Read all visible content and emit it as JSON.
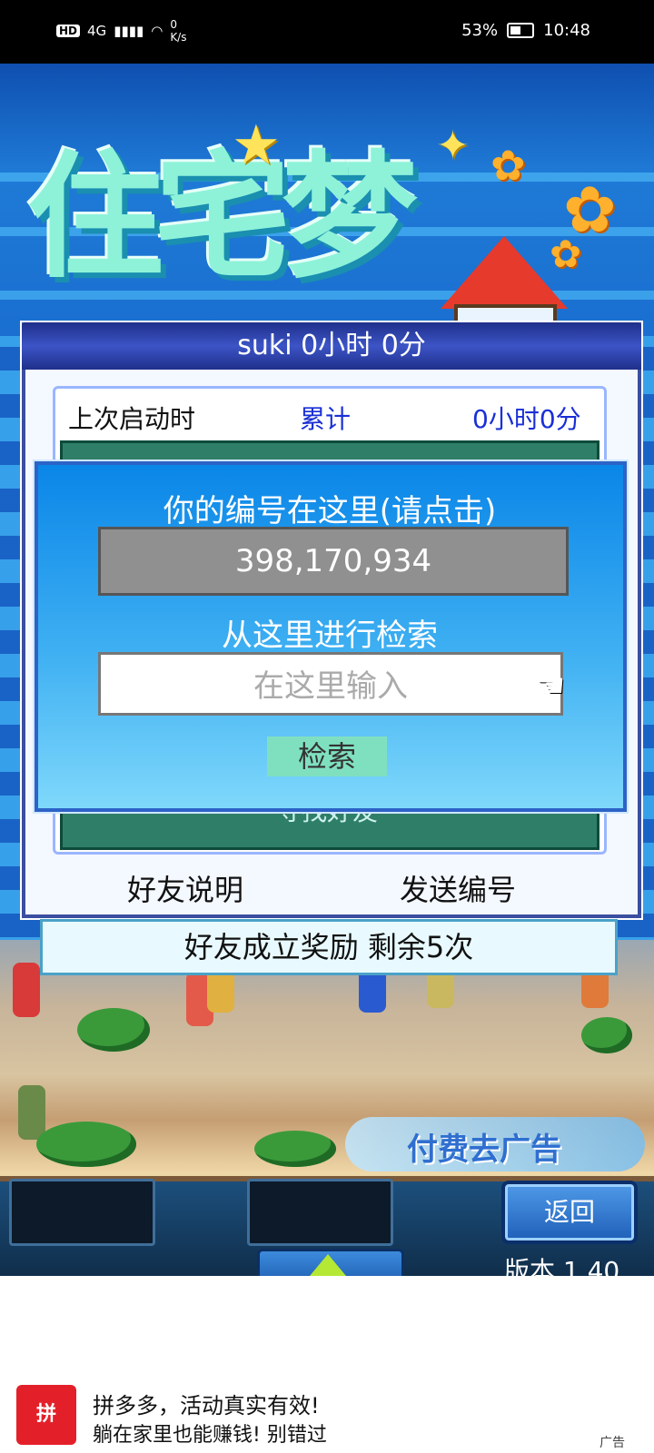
{
  "status_bar": {
    "hd": "HD",
    "network": "4G",
    "speed_value": "0",
    "speed_unit": "K/s",
    "battery": "53%",
    "time": "10:48"
  },
  "game": {
    "title_art": "住宅梦",
    "friend_panel": {
      "header": "suki  0小时 0分",
      "last_launch_label": "上次启动时",
      "cumulative_label": "累计",
      "cumulative_value": "0小时0分",
      "find_friends": "寻找好友",
      "friend_help_button": "好友说明",
      "send_id_button": "发送编号",
      "reward_text": "好友成立奖励  剩余5次"
    },
    "id_dialog": {
      "title": "你的编号在这里(请点击)",
      "player_id": "398,170,934",
      "search_label": "从这里进行检索",
      "search_placeholder": "在这里输入",
      "search_button": "检索"
    },
    "ad_banner_text": "付费去广告",
    "back_button": "返回",
    "version": "版本 1.40"
  },
  "ad_footer": {
    "logo_text": "拼",
    "line1": "拼多多，活动真实有效!",
    "line2": "躺在家里也能赚钱! 别错过",
    "tag": "广告"
  }
}
